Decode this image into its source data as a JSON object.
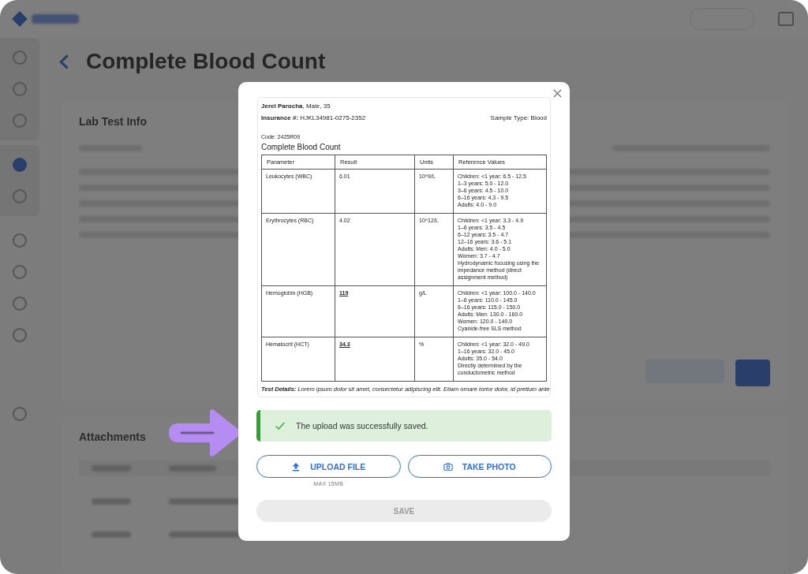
{
  "page": {
    "title": "Complete Blood Count",
    "sections": [
      {
        "title": "Lab Test Info"
      },
      {
        "title": "Attachments"
      }
    ]
  },
  "modal": {
    "document": {
      "patient": "**Jerel Parocha**, Male, 35",
      "insurance": "**Insurance #:** HJKL34981-0275-2352",
      "sample_type": "Sample Type: Blood",
      "code": "Code: 2425R09",
      "title": "Complete Blood Count",
      "columns": [
        "Parameter",
        "Result",
        "Units",
        "Reference Values"
      ],
      "rows": [
        {
          "parameter": "Leukocytes (WBC)",
          "result": "6.01",
          "flagged": false,
          "units": "10^9/L",
          "reference": "Children: <1 year: 6.5 - 12.5\n1–3 years: 5.0 - 12.0\n3–6 years: 4.5 - 10.0\n6–16 years: 4.3 - 9.5\nAdults: 4.0 - 9.0"
        },
        {
          "parameter": "Erythrocytes (RBC)",
          "result": "4.02",
          "flagged": false,
          "units": "10^12/L",
          "reference": "Children: <1 year: 3.3 - 4.9\n1–6 years: 3.5 - 4.5\n6–12 years: 3.5 - 4.7\n12–16 years: 3.6 - 5.1\nAdults: Men: 4.0 - 5.0\nWomen: 3.7 - 4.7\nHydrodynamic focusing using the impedance method (direct assignment method)"
        },
        {
          "parameter": "Hemoglobin (HGB)",
          "result": "119",
          "flagged": true,
          "units": "g/L",
          "reference": "Children: <1 year: 100.0 - 140.0\n1–6 years: 110.0 - 145.0\n6–16 years: 115.0 - 150.0\nAdults: Men: 130.0 - 160.0\nWomen: 120.0 - 140.0\nCyanide-free SLS method"
        },
        {
          "parameter": "Hematocrit (HCT)",
          "result": "34.3",
          "flagged": true,
          "units": "%",
          "reference": "Children: <1 year: 32.0 - 49.0\n1–16 years: 32.0 - 45.0\nAdults: 35.0 - 54.0\nDirectly determined by the conductometric method"
        }
      ],
      "details": "**Test Details:** Lorem ipsum dolor sit amet, consectetur adipiscing elit. Etiam ornare tortor dolor, id pretium ante"
    },
    "alert": {
      "kind": "success",
      "message": "The upload was successfully saved."
    },
    "buttons": [
      {
        "label": "UPLOAD FILE",
        "note": "MAX 15MB"
      },
      {
        "label": "TAKE PHOTO"
      }
    ],
    "save": {
      "label": "SAVE",
      "disabled": true
    }
  }
}
